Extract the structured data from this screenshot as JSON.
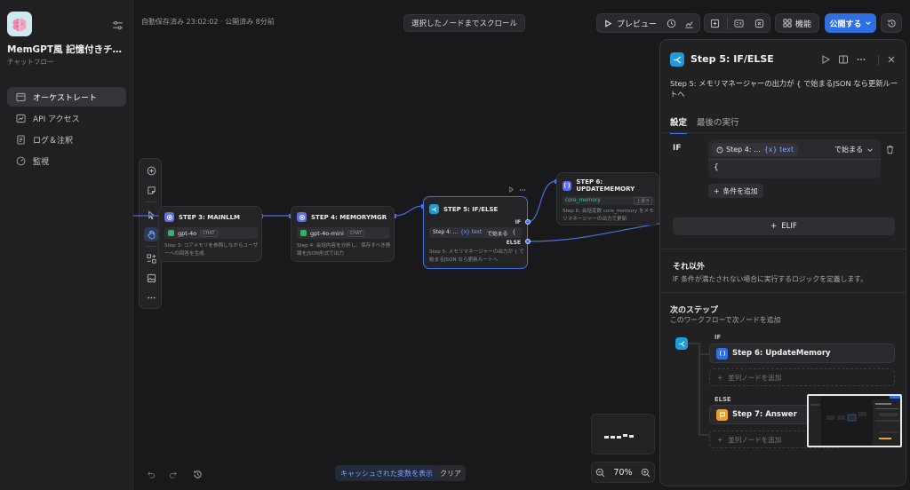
{
  "app": {
    "name": "MemGPT風 記憶付きチャッ...",
    "type": "チャットフロー"
  },
  "sidebar": {
    "items": [
      {
        "label": "オーケストレート",
        "icon": "orchestrate-icon",
        "active": true
      },
      {
        "label": "API アクセス",
        "icon": "api-icon",
        "active": false
      },
      {
        "label": "ログ＆注釈",
        "icon": "logs-icon",
        "active": false
      },
      {
        "label": "監視",
        "icon": "monitor-icon",
        "active": false
      }
    ]
  },
  "topbar": {
    "save_status": "自動保存済み 23:02:02 · 公開済み 8分前",
    "scroll_to_selected": "選択したノードまでスクロール",
    "preview": "プレビュー",
    "features": "機能",
    "publish": "公開する"
  },
  "nodes": {
    "step3": {
      "title": "STEP 3: MAINLLM",
      "model": "gpt-4o",
      "model_tag": "CHAT",
      "desc": "Step 3: コアメモリを参照しながらユーザーへの回答を生成"
    },
    "step4": {
      "title": "STEP 4: MEMORYMGR",
      "model": "gpt-4o-mini",
      "model_tag": "CHAT",
      "desc": "Step 4: 会話内容を分析し、保存すべき情報をJSON形式で出力"
    },
    "step5": {
      "title": "STEP 5: IF/ELSE",
      "if_label": "IF",
      "else_label": "ELSE",
      "cond_var": "Step 4: ...",
      "cond_var_name": "{x} text",
      "cond_op": "で始まる",
      "cond_value": "{",
      "desc": "Step 5: メモリマネージャーの出力が { で始まるJSON なら更新ルートへ"
    },
    "step6": {
      "title": "STEP 6: UPDATEMEMORY",
      "var": "core_memory",
      "var_tag": "上書き",
      "desc": "Step 6: 会話変数 core_memory をメモリマネージャーの出力で更新"
    }
  },
  "canvas": {
    "cache_button": "キャッシュされた変数を表示",
    "clear_button": "クリア",
    "zoom": "70%"
  },
  "panel": {
    "title": "Step 5: IF/ELSE",
    "description": "Step 5: メモリマネージャーの出力が { で始まるJSON なら更新ルートへ",
    "tabs": [
      "設定",
      "最後の実行"
    ],
    "if_label": "IF",
    "condition": {
      "var": "Step 4: ...",
      "var_name": "{x} text",
      "operator": "で始まる",
      "value": "{"
    },
    "add_condition": "条件を追加",
    "elif": "ELIF",
    "else_title": "それ以外",
    "else_desc": "IF 条件が満たされない場合に実行するロジックを定義します。",
    "next_title": "次のステップ",
    "next_desc": "このワークフローで次ノードを追加",
    "branch_if": "IF",
    "branch_if_target": "Step 6: UpdateMemory",
    "branch_else": "ELSE",
    "branch_else_target": "Step 7: Answer",
    "add_parallel": "並列ノードを追加"
  },
  "colors": {
    "accent": "#2f6fe3",
    "ifelse": "#1f9bd8",
    "llm": "#5c6ff0",
    "answer": "#f0a020"
  }
}
